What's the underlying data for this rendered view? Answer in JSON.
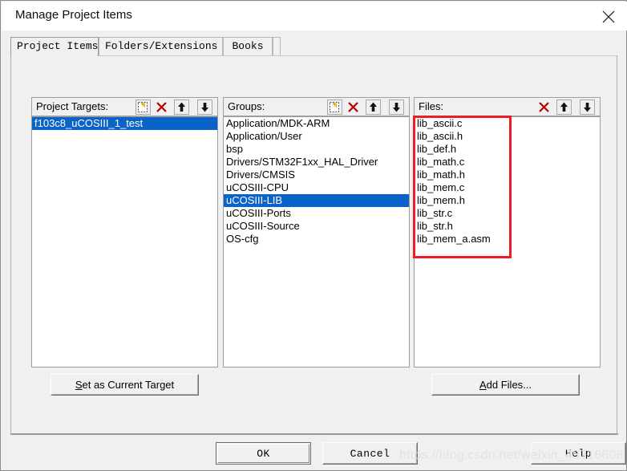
{
  "window": {
    "title": "Manage Project Items",
    "close_icon": "close-icon"
  },
  "tabs": [
    {
      "label": "Project Items",
      "active": true
    },
    {
      "label": "Folders/Extensions",
      "active": false
    },
    {
      "label": "Books",
      "active": false
    }
  ],
  "columns": {
    "targets": {
      "label": "Project Targets:",
      "icons": [
        "new-item-icon",
        "delete-icon",
        "move-up-icon",
        "move-down-icon"
      ],
      "items": [
        "f103c8_uCOSIII_1_test"
      ],
      "selected_index": 0
    },
    "groups": {
      "label": "Groups:",
      "icons": [
        "new-item-icon",
        "delete-icon",
        "move-up-icon",
        "move-down-icon"
      ],
      "items": [
        "Application/MDK-ARM",
        "Application/User",
        "bsp",
        "Drivers/STM32F1xx_HAL_Driver",
        "Drivers/CMSIS",
        "uCOSIII-CPU",
        "uCOSIII-LIB",
        "uCOSIII-Ports",
        "uCOSIII-Source",
        "OS-cfg"
      ],
      "selected_index": 6
    },
    "files": {
      "label": "Files:",
      "icons": [
        "delete-icon",
        "move-up-icon",
        "move-down-icon"
      ],
      "items": [
        "lib_ascii.c",
        "lib_ascii.h",
        "lib_def.h",
        "lib_math.c",
        "lib_math.h",
        "lib_mem.c",
        "lib_mem.h",
        "lib_str.c",
        "lib_str.h",
        "lib_mem_a.asm"
      ],
      "selected_index": -1
    }
  },
  "buttons": {
    "set_current_target": {
      "prefix": "",
      "accel": "S",
      "suffix": "et as Current Target"
    },
    "add_files": {
      "prefix": "",
      "accel": "A",
      "suffix": "dd Files..."
    },
    "ok": "OK",
    "cancel": "Cancel",
    "help": "Help"
  },
  "annotation": {
    "color": "#ee1c25",
    "name": "files-highlight-box"
  },
  "watermark": {
    "text": "https://blog.csdn.net/weixin_45716608",
    "color": "#e2e2e2"
  }
}
